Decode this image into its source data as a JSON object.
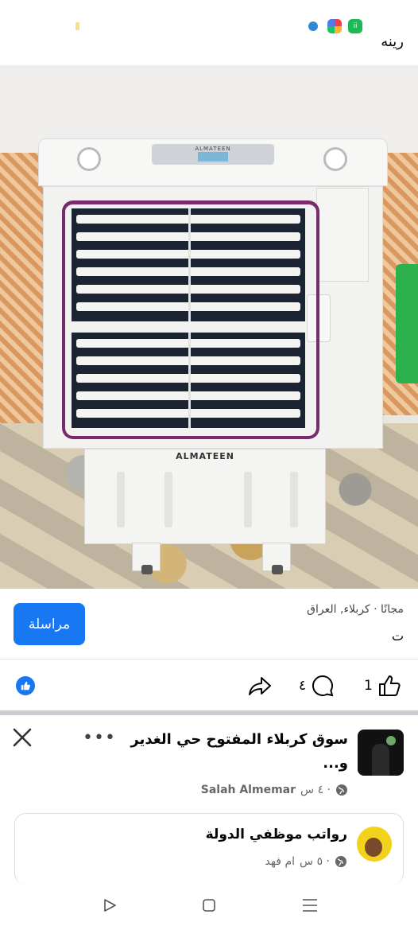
{
  "top": {
    "title_fragment": "رينه",
    "status_icons": [
      "app-icon-blue",
      "app-icon-multicolor",
      "app-icon-green"
    ],
    "green_icon_text": "ii"
  },
  "photo": {
    "brand_body": "ALMATEEN",
    "brand_panel": "ALMATEEN"
  },
  "listing": {
    "price_location": "مجانًا · كربلاء, العراق",
    "second_line": "ت",
    "message_button": "مراسلة"
  },
  "actions": {
    "like_count": "1",
    "comment_count": "٤"
  },
  "post": {
    "group_title": "سوق كربلاء المفتوح حي الغدير و...",
    "author": "Salah Almemar",
    "time": "٤ س ·"
  },
  "card": {
    "title": "رواتب موظفي الدولة",
    "author": "ام فهد",
    "time": "٥ س ·"
  },
  "colors": {
    "accent": "#1877f2",
    "frame_purple": "#7a2a6e",
    "meta_gray": "#65676b"
  }
}
